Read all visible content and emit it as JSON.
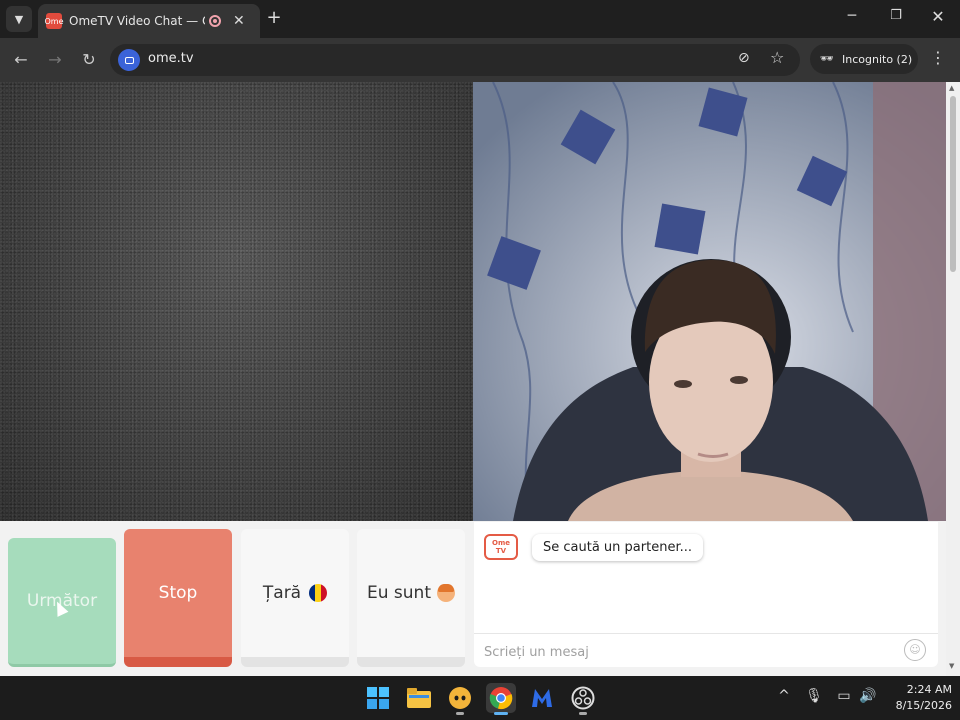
{
  "browser": {
    "tab": {
      "title": "OmeTV Video Chat — Omegle",
      "favicon_label": "Ome",
      "close_glyph": "✕"
    },
    "new_tab_glyph": "+",
    "window_controls": {
      "minimize": "─",
      "maximize": "❐",
      "close": "✕"
    },
    "toolbar": {
      "back": "←",
      "forward": "→",
      "reload": "↻",
      "url": "ome.tv",
      "bookmark_glyph": "☆",
      "eye_glyph": "⊘",
      "menu_glyph": "⋮"
    },
    "incognito": {
      "label": "Incognito (2)"
    }
  },
  "page": {
    "buttons": {
      "next": "Următor",
      "stop": "Stop",
      "country": "Țară",
      "gender": "Eu sunt"
    },
    "chat": {
      "logo_top": "Ome",
      "logo_bottom": "TV",
      "status_message": "Se caută un partener...",
      "input_placeholder": "Scrieți un mesaj",
      "emoji_glyph": "☺"
    }
  },
  "taskbar": {
    "clock": {
      "time": "2:24 AM",
      "date": "8/15/2026"
    },
    "tray_glyphs": {
      "chevron": "^",
      "mic": "🎙",
      "network": "▭",
      "volume": "🔊"
    }
  },
  "colors": {
    "next_button": "#a6dcbc",
    "stop_button": "#e8826e",
    "ome_brand": "#e45b45",
    "chrome_dark": "#1f1f1f"
  }
}
